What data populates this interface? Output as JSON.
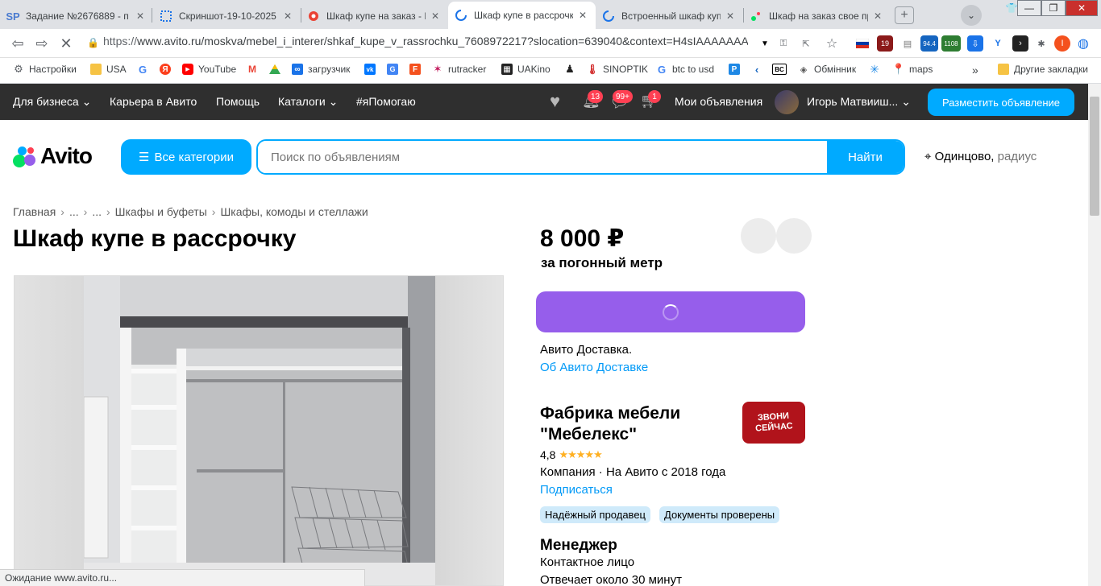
{
  "browser": {
    "tabs": [
      {
        "title": "Задание №2676889 - п",
        "favicon": "SP"
      },
      {
        "title": "Скриншот-19-10-2025 ...",
        "favicon": "screenshot-icon"
      },
      {
        "title": "Шкаф купе на заказ - К",
        "favicon": "record-icon"
      },
      {
        "title": "Шкаф купе в рассрочку",
        "favicon": "loading-icon"
      },
      {
        "title": "Встроенный шкаф купе",
        "favicon": "loading-icon"
      },
      {
        "title": "Шкаф на заказ свое пр",
        "favicon": "avito-icon"
      }
    ],
    "url_scheme": "https://",
    "url_rest": "www.avito.ru/moskva/mebel_i_interer/shkaf_kupe_v_rassrochku_7608972217?slocation=639040&context=H4sIAAAAAAA...",
    "extensions": {
      "ext1_badge": "19",
      "ext2_badge": "94.4",
      "ext3_badge": "1108",
      "profile_letter": "I"
    },
    "bookmarks": [
      {
        "label": "Настройки",
        "icon": "gear-icon"
      },
      {
        "label": "USA",
        "icon": "folder-icon"
      },
      {
        "label": "",
        "icon": "google-icon"
      },
      {
        "label": "",
        "icon": "yandex-icon"
      },
      {
        "label": "YouTube",
        "icon": "youtube-icon"
      },
      {
        "label": "",
        "icon": "gmail-icon"
      },
      {
        "label": "",
        "icon": "drive-icon"
      },
      {
        "label": "загрузчик",
        "icon": "infinity-icon"
      },
      {
        "label": "",
        "icon": "vk-icon"
      },
      {
        "label": "",
        "icon": "translate-icon"
      },
      {
        "label": "",
        "icon": "f-icon"
      },
      {
        "label": "rutracker",
        "icon": "rutracker-icon"
      },
      {
        "label": "UAKino",
        "icon": "uakino-icon"
      },
      {
        "label": "",
        "icon": "pawn-icon"
      },
      {
        "label": "SINOPTIK",
        "icon": "thermometer-icon"
      },
      {
        "label": "btc to usd",
        "icon": "google-icon"
      },
      {
        "label": "",
        "icon": "p-icon"
      },
      {
        "label": "",
        "icon": "arrow-icon"
      },
      {
        "label": "",
        "icon": "bc-icon"
      },
      {
        "label": "Обмінник",
        "icon": "exchange-icon"
      },
      {
        "label": "",
        "icon": "star-icon"
      },
      {
        "label": "maps",
        "icon": "maps-icon"
      }
    ],
    "bookmarks_more": "»",
    "other_bookmarks": "Другие закладки",
    "status": "Ожидание www.avito.ru..."
  },
  "avito_top": {
    "for_business": "Для бизнеса",
    "career": "Карьера в Авито",
    "help": "Помощь",
    "catalogs": "Каталоги",
    "i_help": "#яПомогаю",
    "notif_badge": "13",
    "messages_badge": "99+",
    "cart_badge": "1",
    "my_ads": "Мои объявления",
    "user_name": "Игорь Матвииш...",
    "place_ad": "Разместить объявление"
  },
  "avito_header": {
    "logo": "Avito",
    "all_categories": "Все категории",
    "search_placeholder": "Поиск по объявлениям",
    "find": "Найти",
    "location": "Одинцово,",
    "radius": "радиус"
  },
  "breadcrumbs": [
    "Главная",
    "...",
    "...",
    "Шкафы и буфеты",
    "Шкафы, комоды и стеллажи"
  ],
  "listing": {
    "title": "Шкаф купе в рассрочку",
    "price": "8 000 ₽",
    "price_unit": "за погонный метр",
    "delivery_text": "Авито Доставка.",
    "delivery_link": "Об Авито Доставке"
  },
  "seller": {
    "name": "Фабрика мебели \"Мебелекс\"",
    "rating": "4,8",
    "stars": "★★★★★",
    "company_info": "Компания · На Авито с 2018 года",
    "subscribe": "Подписаться",
    "tags": [
      "Надёжный продавец",
      "Документы проверены"
    ],
    "logo_text": "ЗВОНИ СЕЙЧАС",
    "manager_title": "Менеджер",
    "contact": "Контактное лицо",
    "reply": "Отвечает около 30 минут"
  },
  "colors": {
    "accent": "#00aaff",
    "buy_button": "#965eeb",
    "link": "#0099f7",
    "dark_bar": "#2f2f2f"
  }
}
